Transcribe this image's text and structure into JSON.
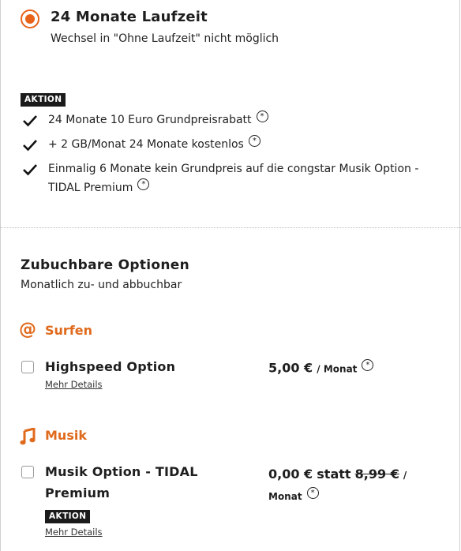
{
  "plan": {
    "title": "24 Monate Laufzeit",
    "subtitle": "Wechsel in \"Ohne Laufzeit\" nicht möglich",
    "badge": "AKTION",
    "promos": [
      "24 Monate 10 Euro Grundpreisrabatt",
      "+ 2 GB/Monat 24 Monate kostenlos",
      "Einmalig 6 Monate kein Grundpreis auf die congstar Musik Option -",
      "TIDAL Premium"
    ],
    "footnote_symbol": "*"
  },
  "options": {
    "title": "Zubuchbare Optionen",
    "subtitle": "Monatlich zu- und abbuchbar",
    "categories": [
      {
        "name": "Surfen",
        "icon": "at-sign-icon",
        "items": [
          {
            "name": "Highspeed Option",
            "price": "5,00 €",
            "unit": "/ Monat",
            "details": "Mehr Details"
          }
        ]
      },
      {
        "name": "Musik",
        "icon": "music-note-icon",
        "items": [
          {
            "name_line1": "Musik Option - TIDAL",
            "name_line2": "Premium",
            "price": "0,00 €",
            "statt": "statt",
            "old_price": "8,99 €",
            "unit_slash": "/",
            "unit_word": "Monat",
            "badge": "AKTION",
            "details": "Mehr Details"
          }
        ]
      }
    ]
  },
  "colors": {
    "accent": "#e8621a",
    "text": "#1e1e1e",
    "badge_bg": "#1b1b1b"
  }
}
